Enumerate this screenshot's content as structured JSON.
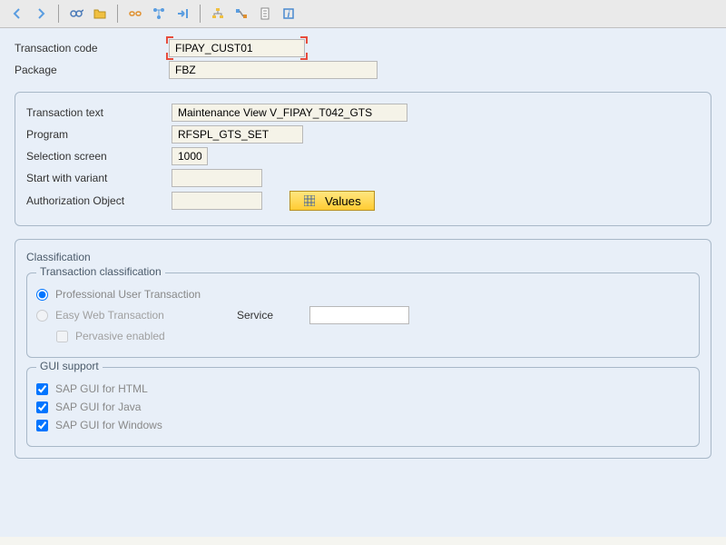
{
  "toolbar": {
    "back_icon": "back",
    "forward_icon": "forward",
    "glasses_icon": "display",
    "folder_icon": "folder",
    "chain_icon": "chain",
    "nodes_icon": "nodes",
    "arrow_icon": "export",
    "hierarchy_icon": "hierarchy",
    "assign_icon": "assign",
    "doc_icon": "document",
    "info_icon": "info"
  },
  "header": {
    "transaction_code_label": "Transaction code",
    "transaction_code_value": "FIPAY_CUST01",
    "package_label": "Package",
    "package_value": "FBZ"
  },
  "details": {
    "transaction_text_label": "Transaction text",
    "transaction_text_value": "Maintenance View V_FIPAY_T042_GTS",
    "program_label": "Program",
    "program_value": "RFSPL_GTS_SET",
    "selection_screen_label": "Selection screen",
    "selection_screen_value": "1000",
    "start_with_variant_label": "Start with variant",
    "start_with_variant_value": "",
    "authorization_object_label": "Authorization Object",
    "authorization_object_value": "",
    "values_button": "Values"
  },
  "classification": {
    "title": "Classification",
    "transaction_classification_title": "Transaction classification",
    "professional_label": "Professional User Transaction",
    "easy_web_label": "Easy Web Transaction",
    "service_label": "Service",
    "pervasive_label": "Pervasive enabled",
    "gui_support_title": "GUI support",
    "gui_html_label": "SAP GUI for HTML",
    "gui_java_label": "SAP GUI for Java",
    "gui_windows_label": "SAP GUI for Windows"
  }
}
